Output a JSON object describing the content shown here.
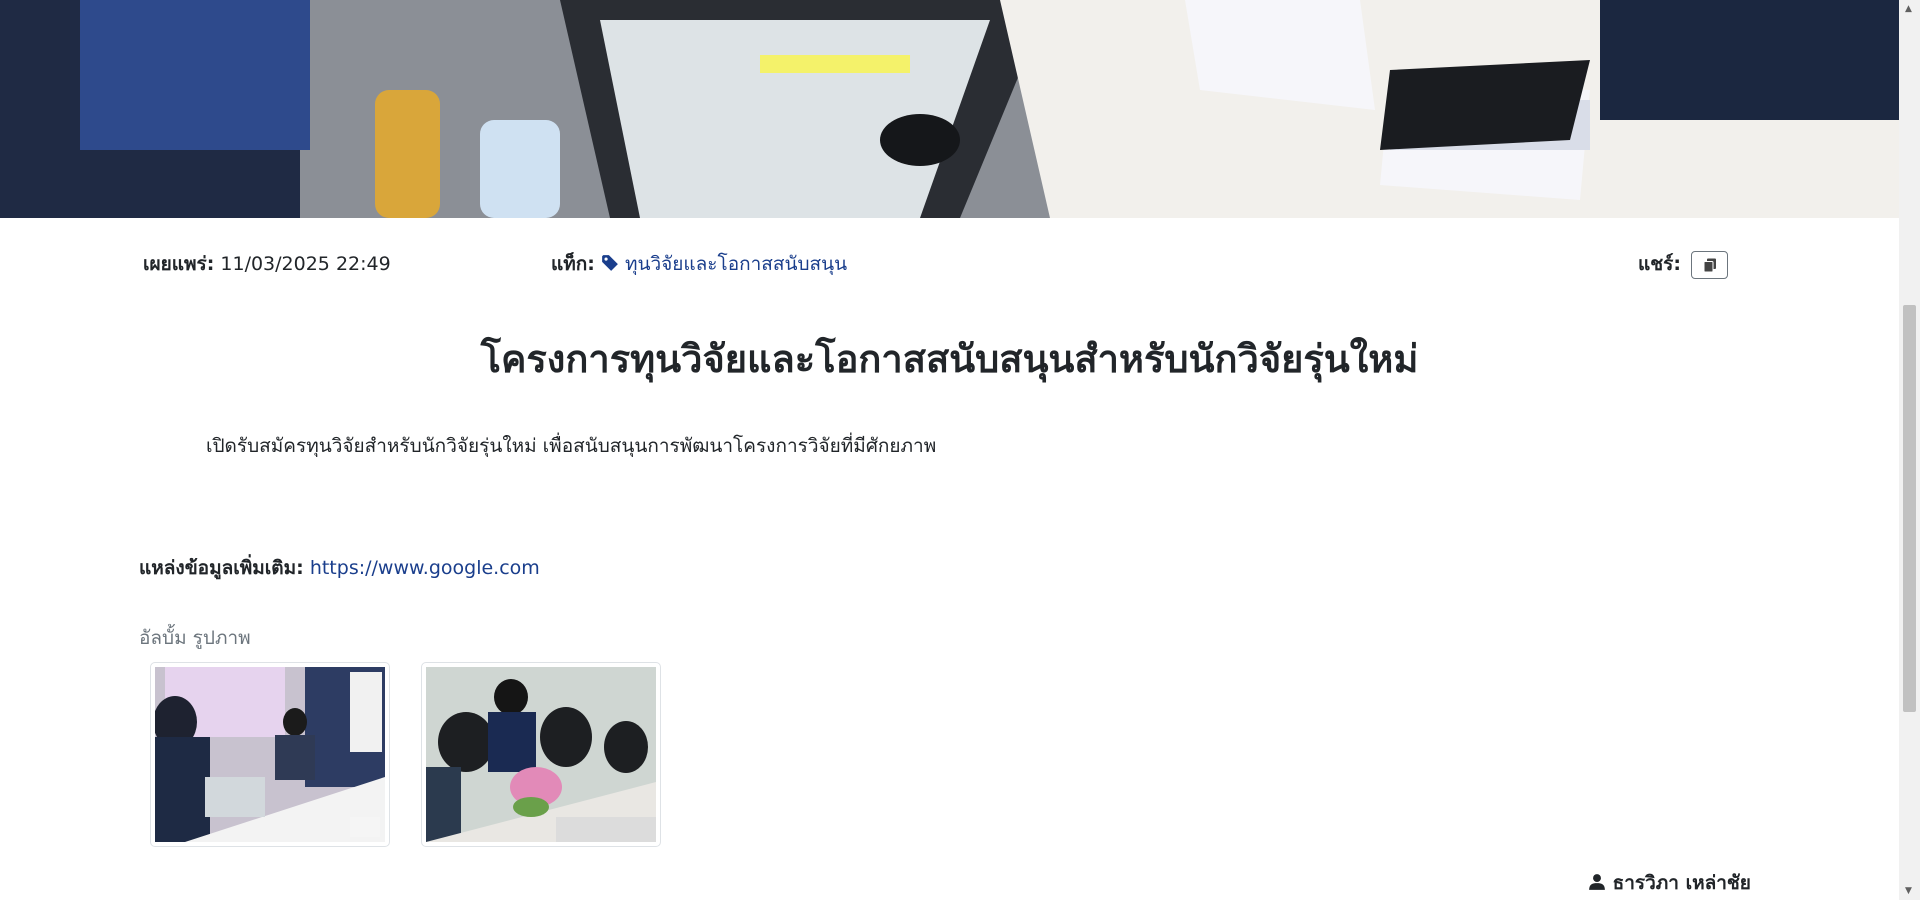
{
  "meta": {
    "published_label": "เผยแพร่:",
    "published_value": "11/03/2025 22:49",
    "tag_label": "แท็ก:",
    "tag_value": "ทุนวิจัยและโอกาสสนับสนุน",
    "share_label": "แชร์:"
  },
  "article": {
    "title": "โครงการทุนวิจัยและโอกาสสนับสนุนสำหรับนักวิจัยรุ่นใหม่",
    "description": "เปิดรับสมัครทุนวิจัยสำหรับนักวิจัยรุ่นใหม่ เพื่อสนับสนุนการพัฒนาโครงการวิจัยที่มีศักยภาพ",
    "source_label": "แหล่งข้อมูลเพิ่มเติม:",
    "source_url": "https://www.google.com"
  },
  "album": {
    "label": "อัลบั้ม รูปภาพ"
  },
  "author": {
    "name": "ธารวิภา เหล่าชัย"
  },
  "icons": [
    "tag-icon",
    "copy-icon",
    "user-icon"
  ],
  "colors": {
    "link": "#1a3e8c",
    "muted": "#6c757d",
    "text": "#212529"
  }
}
